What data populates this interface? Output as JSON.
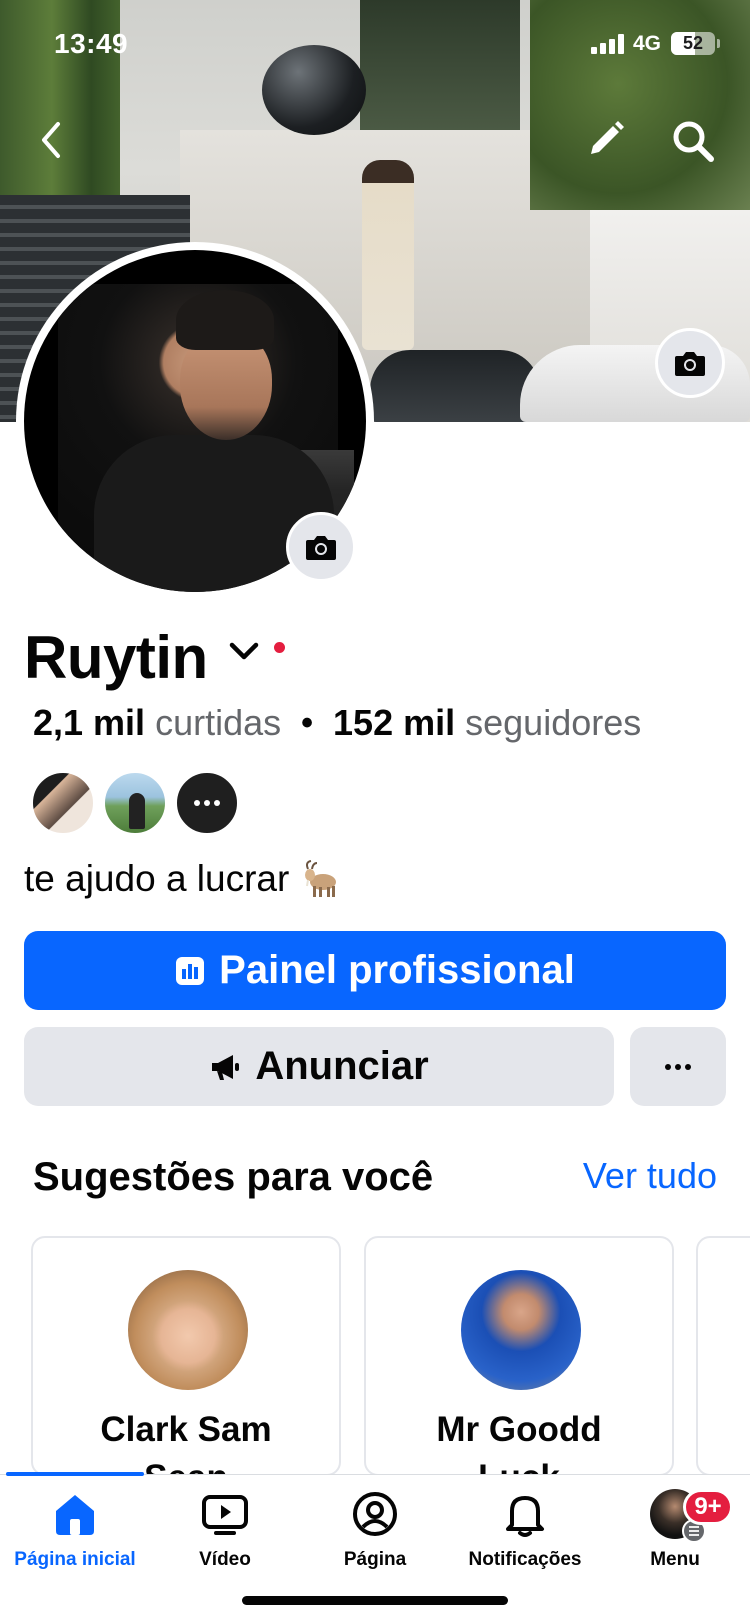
{
  "status_bar": {
    "time": "13:49",
    "network": "4G",
    "battery": "52",
    "battery_level": 0.52
  },
  "header": {
    "back_icon": "chevron-left-icon",
    "edit_icon": "pencil-icon",
    "search_icon": "search-icon",
    "cover_camera_icon": "camera-icon",
    "avatar_camera_icon": "camera-icon"
  },
  "profile": {
    "name": "Ruytin",
    "likes_value": "2,1 mil",
    "likes_label": "curtidas",
    "separator": "•",
    "followers_value": "152 mil",
    "followers_label": "seguidores",
    "bio": "te ajudo a lucrar",
    "bio_emoji": "goat-icon"
  },
  "buttons": {
    "primary_label": "Painel profissional",
    "secondary_label": "Anunciar",
    "more_icon": "more-horizontal-icon"
  },
  "suggestions": {
    "title": "Sugestões para você",
    "see_all": "Ver tudo",
    "cards": [
      {
        "name_line1": "Clark Sam",
        "name_line2": "Sean"
      },
      {
        "name_line1": "Mr Goodd",
        "name_line2": "Luck"
      }
    ]
  },
  "tabbar": {
    "tabs": [
      {
        "label": "Página inicial",
        "icon": "home-icon",
        "active": true
      },
      {
        "label": "Vídeo",
        "icon": "video-icon",
        "active": false
      },
      {
        "label": "Página",
        "icon": "page-profile-icon",
        "active": false
      },
      {
        "label": "Notificações",
        "icon": "bell-icon",
        "active": false
      },
      {
        "label": "Menu",
        "icon": "avatar-menu-icon",
        "active": false
      }
    ],
    "menu_badge": "9+"
  },
  "colors": {
    "primary": "#0866ff",
    "secondary_bg": "#e4e6eb",
    "badge": "#e41e3f",
    "muted_text": "#65676b"
  }
}
